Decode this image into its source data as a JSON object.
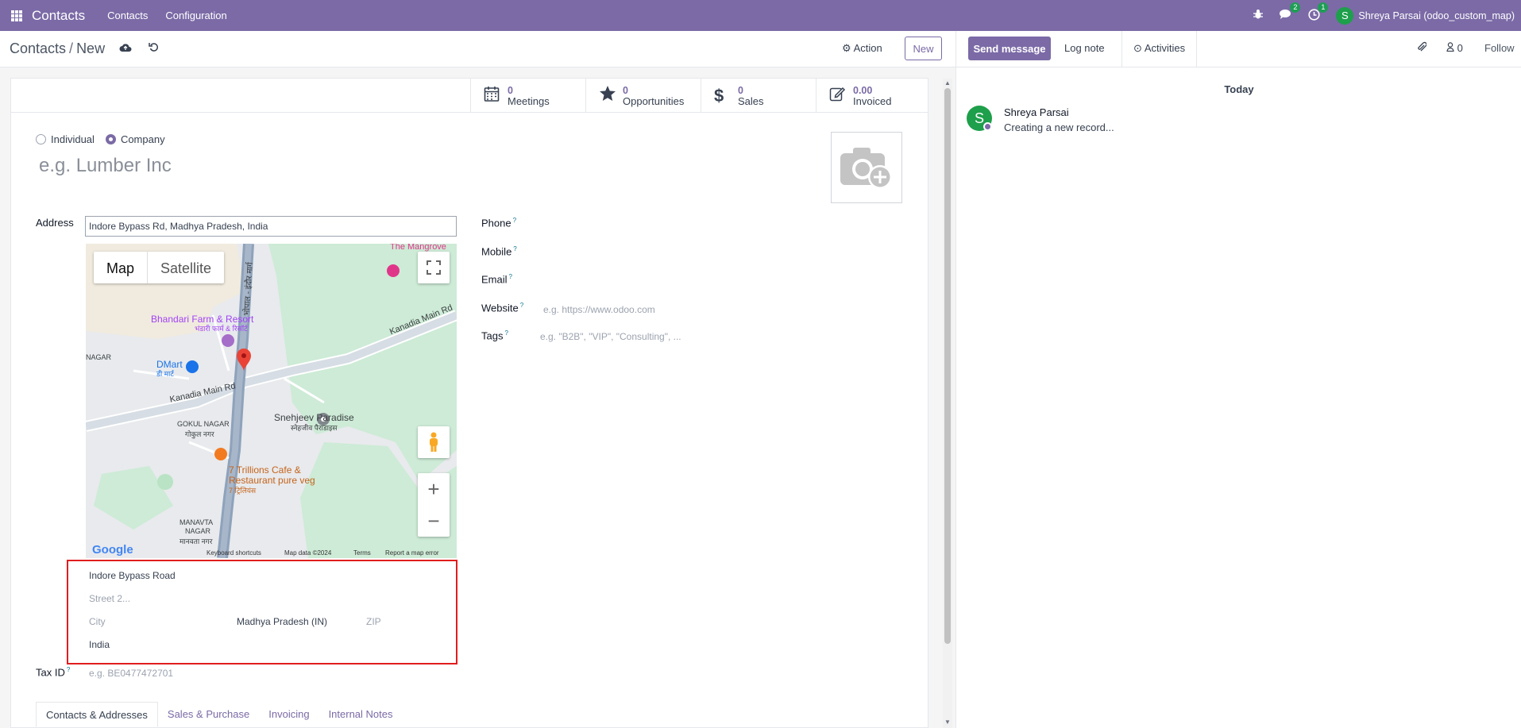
{
  "topbar": {
    "app_name": "Contacts",
    "nav": [
      "Contacts",
      "Configuration"
    ],
    "messages_badge": "2",
    "activities_badge": "1",
    "user_initial": "S",
    "user_name": "Shreya Parsai (odoo_custom_map)"
  },
  "control": {
    "breadcrumb_parent": "Contacts",
    "breadcrumb_separator": "/",
    "breadcrumb_current": "New",
    "action_label": "Action",
    "new_label": "New"
  },
  "stats": [
    {
      "num": "0",
      "label": "Meetings",
      "icon": "calendar-icon"
    },
    {
      "num": "0",
      "label": "Opportunities",
      "icon": "star-icon"
    },
    {
      "num": "0",
      "label": "Sales",
      "icon": "dollar-icon"
    },
    {
      "num": "0.00",
      "label": "Invoiced",
      "icon": "edit-icon"
    }
  ],
  "form": {
    "radio_individual": "Individual",
    "radio_company": "Company",
    "selected_type": "Company",
    "name_placeholder": "e.g. Lumber Inc",
    "address_label": "Address",
    "address_value": "Indore Bypass Rd, Madhya Pradesh, India",
    "street": "Indore Bypass Road",
    "street2_placeholder": "Street 2...",
    "city_placeholder": "City",
    "state": "Madhya Pradesh (IN)",
    "zip_placeholder": "ZIP",
    "country": "India",
    "tax_id_label": "Tax ID",
    "tax_id_placeholder": "e.g. BE0477472701",
    "phone_label": "Phone",
    "mobile_label": "Mobile",
    "email_label": "Email",
    "website_label": "Website",
    "website_placeholder": "e.g. https://www.odoo.com",
    "tags_label": "Tags",
    "tags_placeholder": "e.g. \"B2B\", \"VIP\", \"Consulting\", ..."
  },
  "map": {
    "map_label": "Map",
    "satellite_label": "Satellite",
    "places": {
      "bhandari": "Bhandari Farm & Resort",
      "bhandari_hi": "भंडारी फार्म & रिसॉर्ट",
      "dmart": "DMart",
      "dmart_hi": "डी मार्ट",
      "kanadia1": "Kanadia Main Rd",
      "kanadia2": "Kanadia Main Rd",
      "gokul": "GOKUL NAGAR",
      "gokul_hi": "गोकुल नगर",
      "snehjeev": "Snehjeev Paradise",
      "snehjeev_hi": "स्नेहजीव पैराडाइस",
      "trillions": "7 Trillions Cafe &",
      "trillions2": "Restaurant pure veg",
      "trillions_hi": "7 ट्रिलियंस",
      "manavta": "MANAVTA",
      "manavta2": "NAGAR",
      "manavta_hi": "मानवता नगर",
      "mangrove": "The Mangrove",
      "nagar": "NAGAR",
      "bhopal_road": "भोपाल - इंदौर मार्ग"
    },
    "footer": {
      "google": "Google",
      "shortcuts": "Keyboard shortcuts",
      "data": "Map data ©2024",
      "terms": "Terms",
      "report": "Report a map error"
    }
  },
  "tabs": [
    "Contacts & Addresses",
    "Sales & Purchase",
    "Invoicing",
    "Internal Notes"
  ],
  "active_tab": "Contacts & Addresses",
  "chatter": {
    "send_message": "Send message",
    "log_note": "Log note",
    "activities": "Activities",
    "followers_count": "0",
    "follow": "Follow",
    "date_separator": "Today",
    "message_author": "Shreya Parsai",
    "message_initial": "S",
    "message_body": "Creating a new record..."
  },
  "colors": {
    "brand": "#7b6aa6",
    "highlight": "#e11d1d"
  }
}
